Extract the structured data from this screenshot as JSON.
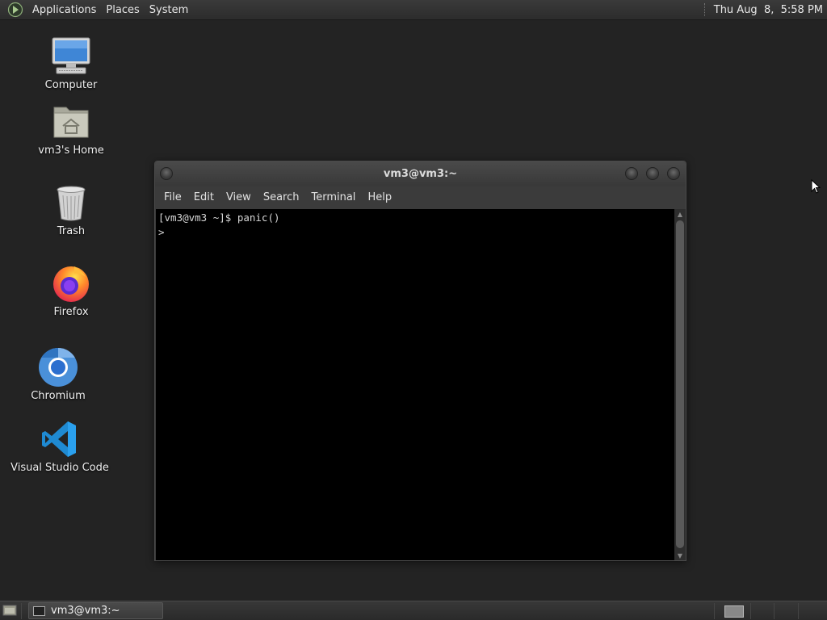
{
  "top_panel": {
    "menus": [
      "Applications",
      "Places",
      "System"
    ],
    "clock": "Thu Aug  8,  5:58 PM"
  },
  "desktop_icons": [
    {
      "label": "Computer",
      "icon": "computer-icon"
    },
    {
      "label": "vm3's Home",
      "icon": "home-folder-icon"
    },
    {
      "label": "Trash",
      "icon": "trash-icon"
    },
    {
      "label": "Firefox",
      "icon": "firefox-icon"
    },
    {
      "label": "Chromium",
      "icon": "chromium-icon"
    },
    {
      "label": "Visual Studio Code",
      "icon": "vscode-icon"
    }
  ],
  "terminal": {
    "title": "vm3@vm3:~",
    "menu": [
      "File",
      "Edit",
      "View",
      "Search",
      "Terminal",
      "Help"
    ],
    "lines": [
      "[vm3@vm3 ~]$ panic()",
      ">"
    ]
  },
  "taskbar": {
    "window_button": "vm3@vm3:~"
  },
  "colors": {
    "desktop_bg": "#232323",
    "panel_bg": "#323232",
    "terminal_bg": "#000000",
    "firefox_orange": "#ff7139",
    "chromium_blue": "#4a90d9",
    "vscode_blue": "#1f8ad2"
  }
}
